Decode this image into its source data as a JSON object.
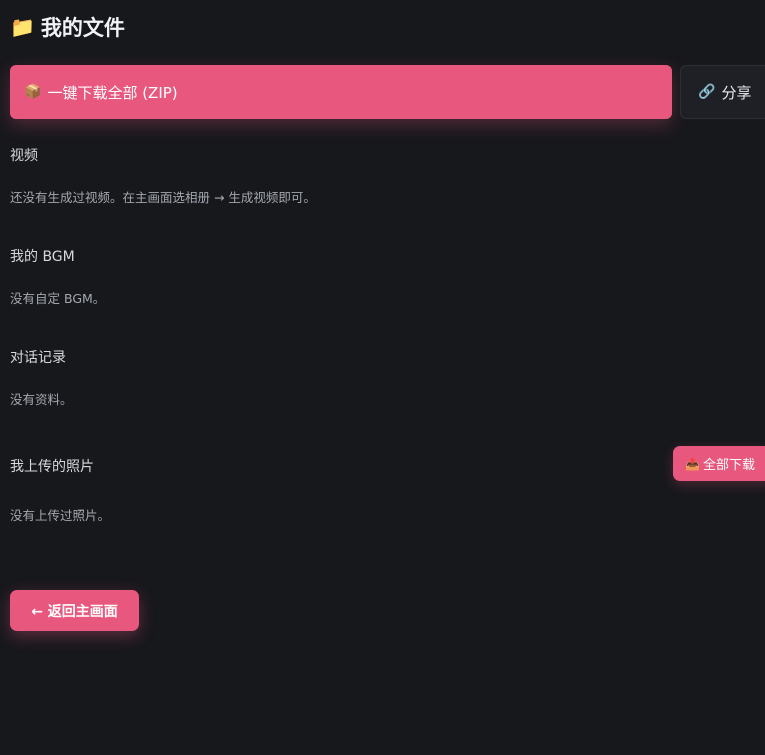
{
  "header": {
    "icon": "folder-icon",
    "icon_glyph": "📁",
    "title": "我的文件"
  },
  "toolbar": {
    "zip_icon": "package-icon",
    "zip_glyph": "📦",
    "zip_label": "一键下载全部 (ZIP)",
    "share_icon": "link-icon",
    "share_glyph": "🔗",
    "share_label": "分享"
  },
  "sections": {
    "videos": {
      "title": "视频",
      "empty_text": "还没有生成过视频。在主画面选相册 → 生成视频即可。"
    },
    "bgm": {
      "title": "我的 BGM",
      "empty_text": "没有自定 BGM。"
    },
    "chat": {
      "title": "对话记录",
      "empty_text": "没有资料。"
    },
    "photos": {
      "title": "我上传的照片",
      "download_icon": "outbox-tray-icon",
      "download_glyph": "📤",
      "download_label": "全部下载",
      "empty_text": "没有上传过照片。"
    }
  },
  "footer": {
    "back_label": "← 返回主画面"
  },
  "colors": {
    "background": "#17181c",
    "accent": "#e8577d",
    "secondary_button": "#1e2025"
  }
}
